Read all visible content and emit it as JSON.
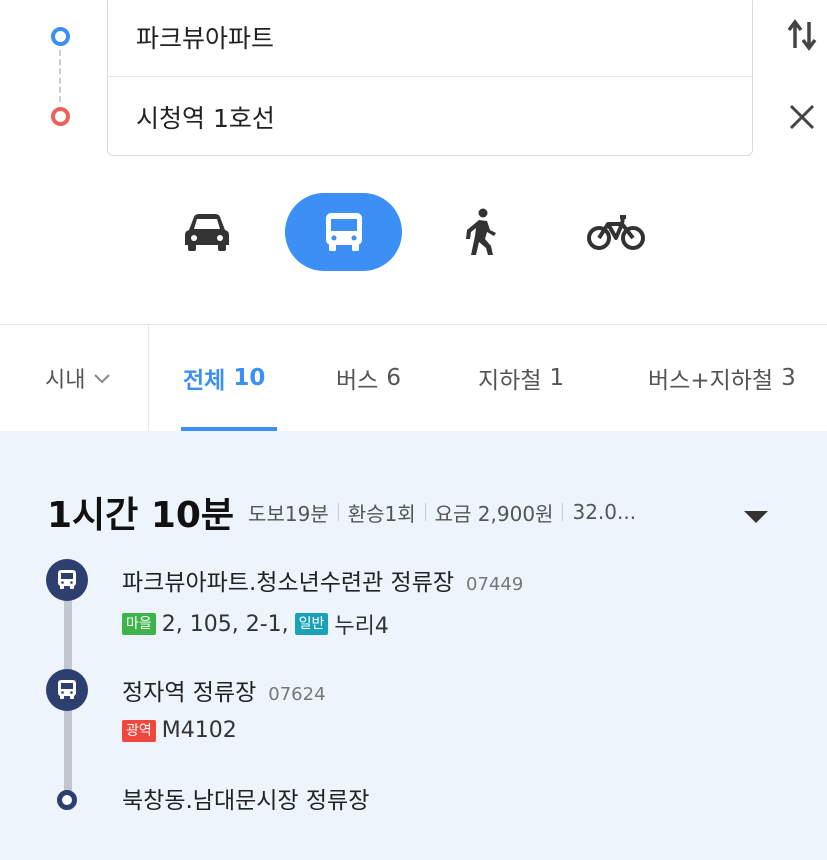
{
  "search": {
    "start": "파크뷰아파트",
    "destination": "시청역 1호선"
  },
  "modes": [
    {
      "icon": "car-icon",
      "active": false
    },
    {
      "icon": "bus-icon",
      "active": true
    },
    {
      "icon": "walk-icon",
      "active": false
    },
    {
      "icon": "bike-icon",
      "active": false
    }
  ],
  "colors": {
    "accent": "#3b8ff5",
    "start_dot": "#3b8ff5",
    "end_dot": "#f0605b",
    "marker": "#2d3f6e",
    "panel_bg": "#edf4fc"
  },
  "tabs": {
    "region": "시내",
    "items": [
      {
        "label": "전체",
        "count": "10",
        "active": true
      },
      {
        "label": "버스",
        "count": "6",
        "active": false
      },
      {
        "label": "지하철",
        "count": "1",
        "active": false
      },
      {
        "label": "버스+지하철",
        "count": "3",
        "active": false
      }
    ]
  },
  "result": {
    "duration": "1시간 10분",
    "walk": "도보19분",
    "transfers": "환승1회",
    "fare": "요금 2,900원",
    "distance": "32.0..."
  },
  "steps": [
    {
      "stop": "파크뷰아파트.청소년수련관 정류장",
      "code": "07449",
      "badge1": "마을",
      "routes1": "2, 105, 2-1,",
      "badge2": "일반",
      "routes2": "누리4"
    },
    {
      "stop": "정자역 정류장",
      "code": "07624",
      "badge1": "광역",
      "routes1": "M4102"
    },
    {
      "stop": "북창동.남대문시장 정류장"
    }
  ]
}
